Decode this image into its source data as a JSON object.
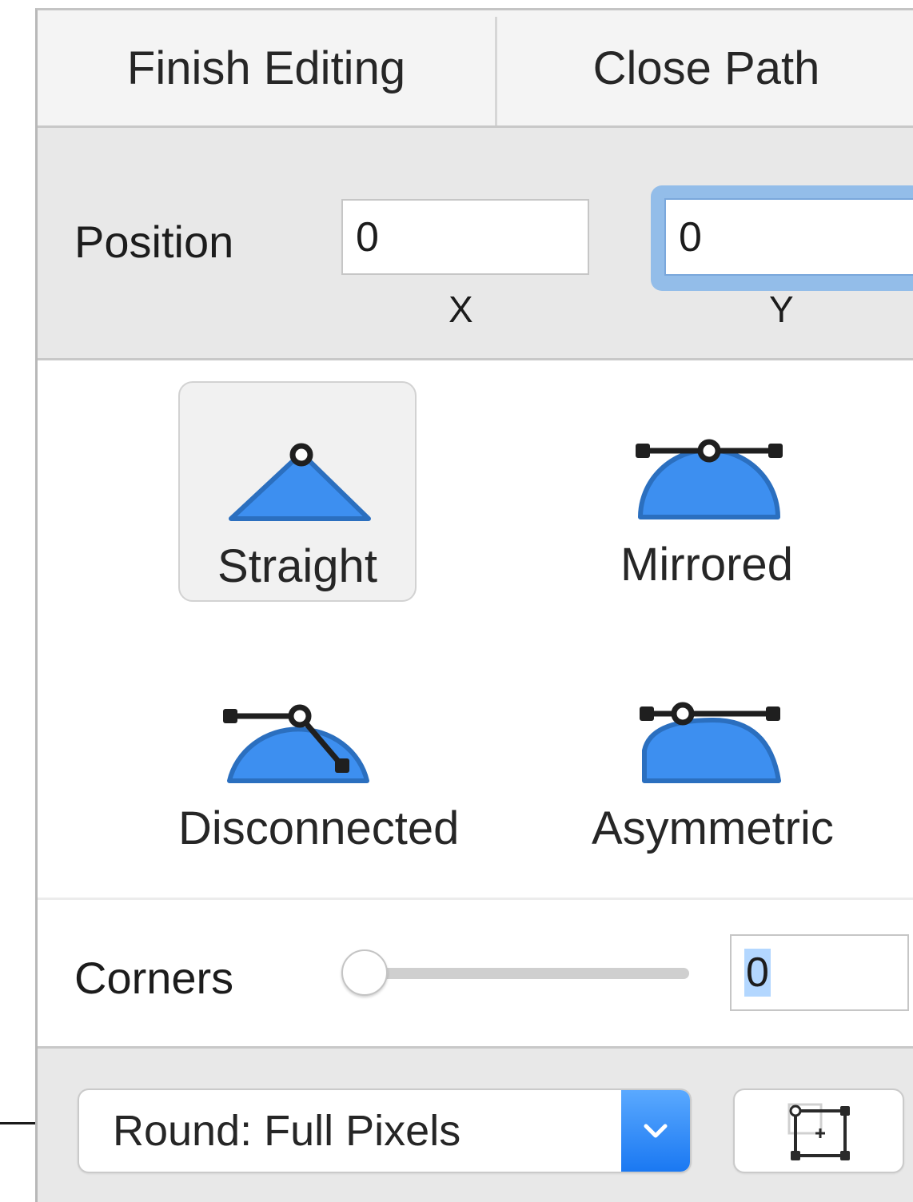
{
  "header": {
    "finish_label": "Finish Editing",
    "close_label": "Close Path"
  },
  "position": {
    "label": "Position",
    "x_value": "0",
    "y_value": "0",
    "x_axis_label": "X",
    "y_axis_label": "Y"
  },
  "point_types": [
    {
      "label": "Straight",
      "icon": "straight-point-icon",
      "selected": true
    },
    {
      "label": "Mirrored",
      "icon": "mirrored-point-icon",
      "selected": false
    },
    {
      "label": "Disconnected",
      "icon": "disconnected-point-icon",
      "selected": false
    },
    {
      "label": "Asymmetric",
      "icon": "asymmetric-point-icon",
      "selected": false
    }
  ],
  "corners": {
    "label": "Corners",
    "value": "0",
    "slider_fraction": 0
  },
  "rounding": {
    "selected": "Round: Full Pixels"
  },
  "colors": {
    "accent_blue": "#3d8ff0",
    "shape_fill": "#3d8ff0",
    "shape_edge": "#2b6fbf",
    "handle": "#1f1f1f"
  }
}
